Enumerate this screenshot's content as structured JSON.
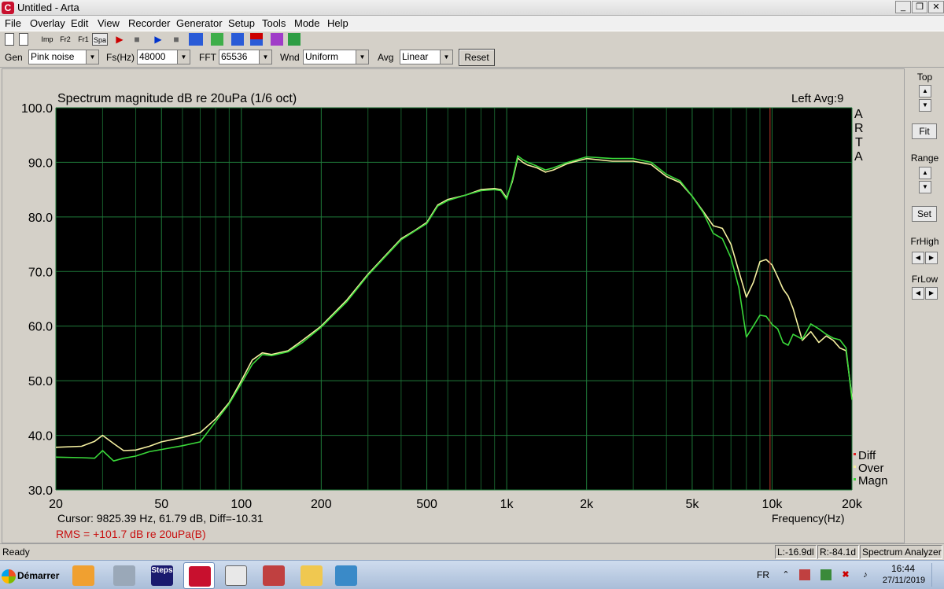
{
  "window": {
    "title": "Untitled - Arta",
    "app_icon": "arta-icon",
    "minimize_icon": "_",
    "restore_icon": "❐",
    "close_icon": "✕"
  },
  "menu": [
    "File",
    "Overlay",
    "Edit",
    "View",
    "Recorder",
    "Generator",
    "Setup",
    "Tools",
    "Mode",
    "Help"
  ],
  "toolbar1": {
    "buttons": [
      "Imp",
      "Fr2",
      "Fr1",
      "Spa"
    ]
  },
  "toolbar2": {
    "gen_label": "Gen",
    "gen_value": "Pink noise",
    "fs_label": "Fs(Hz)",
    "fs_value": "48000",
    "fft_label": "FFT",
    "fft_value": "65536",
    "wnd_label": "Wnd",
    "wnd_value": "Uniform",
    "avg_label": "Avg",
    "avg_value": "Linear",
    "reset_label": "Reset"
  },
  "plot": {
    "title": "Spectrum magnitude dB re 20uPa (1/6 oct)",
    "channel_info": "Left  Avg:9",
    "brand_letters": [
      "A",
      "R",
      "T",
      "A"
    ],
    "cursor_text": "Cursor:  9825.39 Hz, 61.79 dB,  Diff=-10.31",
    "rms_text": "RMS = +101.7 dB re 20uPa(B)",
    "xlabel": "Frequency(Hz)",
    "colors": {
      "background": "#000000",
      "grid": "#1f7a3a",
      "over": "#f5f0a0",
      "magn": "#3ad83a",
      "diff": "#e02020",
      "cursor": "#c0392b",
      "rms": "#c81010"
    }
  },
  "chart_data": {
    "type": "line",
    "title": "Spectrum magnitude dB re 20uPa (1/6 oct)",
    "xlabel": "Frequency(Hz)",
    "ylabel": "",
    "xscale": "log",
    "xlim": [
      20,
      20000
    ],
    "ylim": [
      30,
      100
    ],
    "xticks": [
      20,
      50,
      100,
      200,
      500,
      1000,
      2000,
      5000,
      10000,
      20000
    ],
    "xtick_labels": [
      "20",
      "50",
      "100",
      "200",
      "500",
      "1k",
      "2k",
      "5k",
      "10k",
      "20k"
    ],
    "yticks": [
      30,
      40,
      50,
      60,
      70,
      80,
      90,
      100
    ],
    "ytick_labels": [
      "30.0",
      "40.0",
      "50.0",
      "60.0",
      "70.0",
      "80.0",
      "90.0",
      "100.0"
    ],
    "grid": true,
    "legend": [
      "Diff",
      "Over",
      "Magn"
    ],
    "legend_position": "bottom-right",
    "cursor_hz": 9825.39,
    "series": [
      {
        "name": "Over",
        "color": "#f5f0a0",
        "x": [
          20,
          25,
          28,
          30,
          33,
          36,
          40,
          45,
          50,
          60,
          70,
          80,
          90,
          100,
          110,
          120,
          130,
          150,
          170,
          200,
          250,
          300,
          350,
          400,
          450,
          500,
          550,
          600,
          700,
          800,
          900,
          950,
          1000,
          1050,
          1100,
          1150,
          1200,
          1300,
          1400,
          1500,
          1700,
          2000,
          2500,
          3000,
          3500,
          4000,
          4500,
          5000,
          5500,
          6000,
          6500,
          7000,
          7500,
          8000,
          8500,
          9000,
          9500,
          10000,
          10500,
          11000,
          11500,
          12000,
          13000,
          14000,
          15000,
          16000,
          17000,
          18000,
          19000,
          20000
        ],
        "y": [
          37.8,
          38.0,
          38.9,
          40.0,
          38.5,
          37.2,
          37.3,
          38.0,
          38.8,
          39.6,
          40.5,
          43.0,
          46.0,
          50.0,
          53.8,
          55.1,
          54.8,
          55.5,
          57.4,
          60.0,
          64.8,
          69.5,
          73.0,
          76.0,
          77.5,
          79.0,
          82.2,
          83.2,
          84.0,
          85.0,
          85.2,
          85.0,
          83.5,
          86.5,
          90.8,
          90.0,
          89.5,
          89.0,
          88.2,
          88.6,
          89.8,
          90.7,
          90.2,
          90.2,
          89.6,
          87.4,
          86.3,
          83.8,
          81.0,
          78.4,
          77.9,
          75.0,
          70.0,
          65.3,
          68.0,
          71.8,
          72.2,
          71.2,
          69.0,
          66.8,
          65.5,
          63.2,
          57.4,
          59.0,
          57.0,
          58.2,
          57.4,
          56.0,
          55.5,
          47.0
        ]
      },
      {
        "name": "Magn",
        "color": "#3ad83a",
        "x": [
          20,
          25,
          28,
          30,
          33,
          36,
          40,
          45,
          50,
          60,
          70,
          80,
          90,
          100,
          110,
          120,
          130,
          150,
          170,
          200,
          250,
          300,
          350,
          400,
          450,
          500,
          550,
          600,
          700,
          800,
          900,
          950,
          1000,
          1050,
          1100,
          1150,
          1200,
          1300,
          1400,
          1500,
          1700,
          2000,
          2500,
          3000,
          3500,
          4000,
          4500,
          5000,
          5500,
          6000,
          6500,
          7000,
          7500,
          8000,
          8500,
          9000,
          9500,
          10000,
          10500,
          11000,
          11500,
          12000,
          13000,
          14000,
          15000,
          16000,
          17000,
          18000,
          19000,
          20000
        ],
        "y": [
          36.0,
          35.9,
          35.8,
          37.2,
          35.3,
          35.8,
          36.2,
          37.0,
          37.4,
          38.1,
          38.8,
          42.5,
          45.8,
          49.5,
          53.0,
          54.8,
          54.6,
          55.3,
          57.0,
          59.8,
          64.5,
          69.3,
          72.8,
          75.8,
          77.4,
          78.8,
          82.0,
          83.0,
          84.0,
          84.8,
          85.0,
          84.8,
          83.2,
          86.8,
          91.2,
          90.5,
          90.0,
          89.3,
          88.6,
          89.0,
          90.0,
          91.0,
          90.7,
          90.7,
          90.0,
          87.8,
          86.6,
          83.8,
          80.8,
          77.0,
          76.0,
          72.5,
          67.0,
          58.0,
          60.0,
          62.0,
          61.8,
          60.3,
          59.5,
          57.0,
          56.5,
          58.5,
          57.6,
          60.4,
          59.5,
          58.5,
          57.8,
          57.5,
          56.0,
          46.5
        ]
      }
    ]
  },
  "right_panel": {
    "top_label": "Top",
    "fit_label": "Fit",
    "range_label": "Range",
    "set_label": "Set",
    "frhigh_label": "FrHigh",
    "frlow_label": "FrLow"
  },
  "status": {
    "ready": "Ready",
    "left_level": "L:-16.9dl",
    "right_level": "R:-84.1d",
    "mode": "Spectrum Analyzer"
  },
  "taskbar": {
    "start_label": "Démarrer",
    "steps_label": "Steps",
    "lang": "FR",
    "time": "16:44",
    "date": "27/11/2019"
  }
}
